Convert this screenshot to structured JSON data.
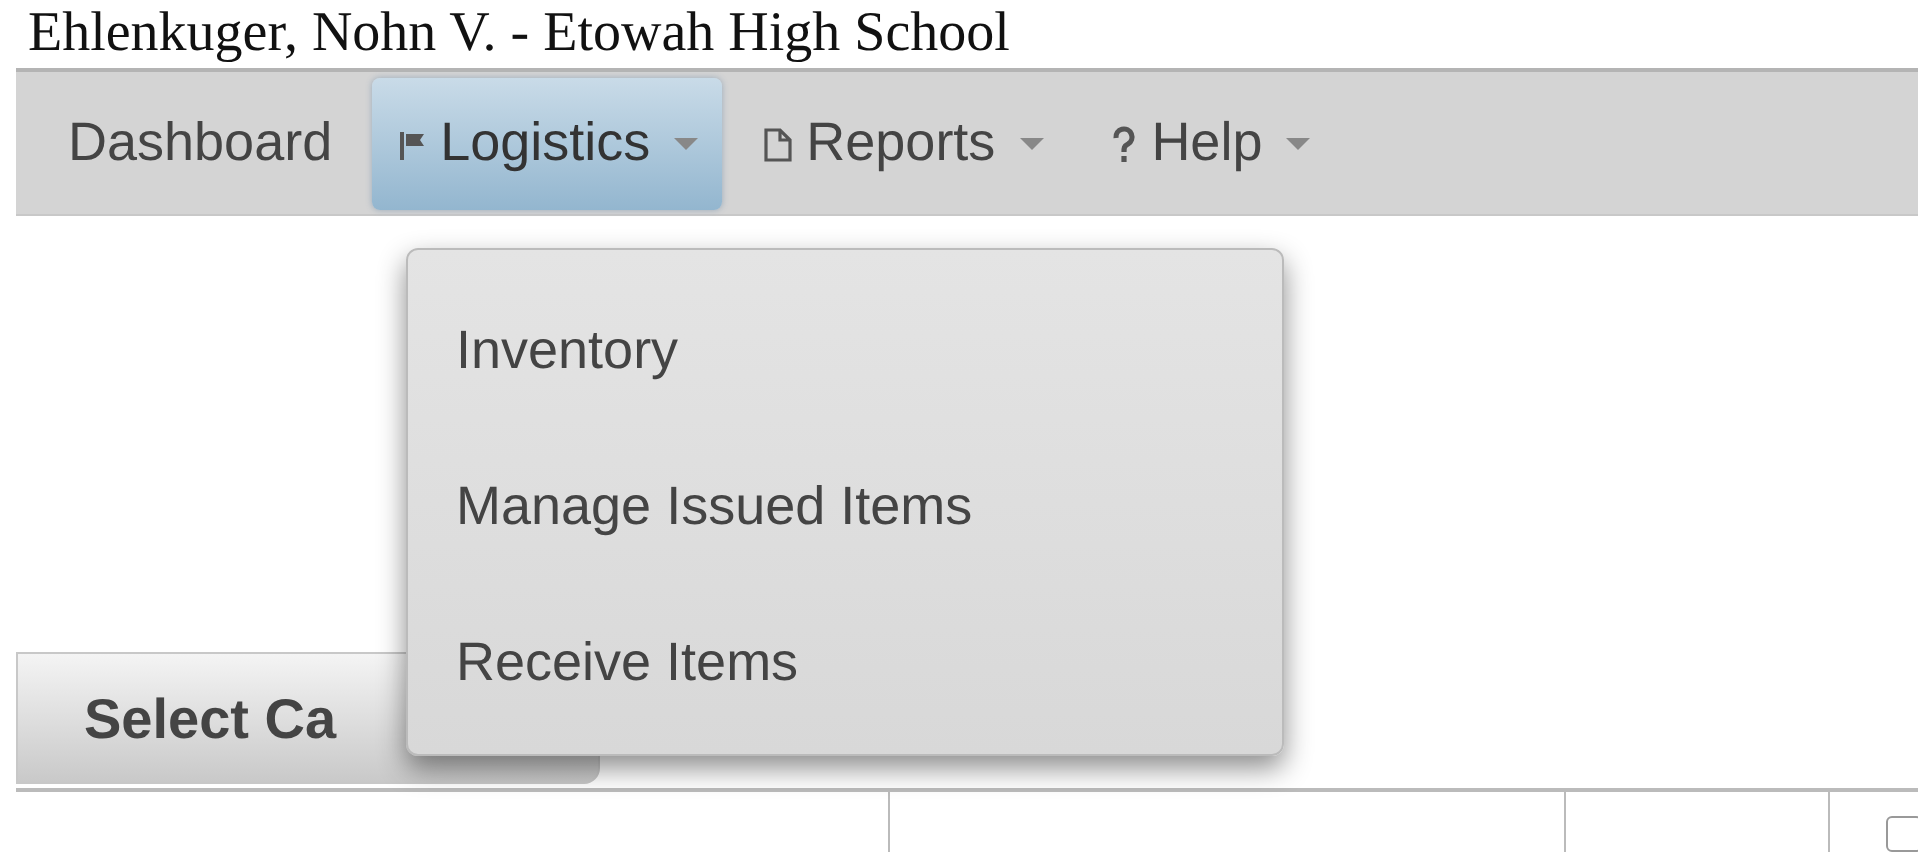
{
  "page_header": {
    "title": "Ehlenkuger, Nohn V. - Etowah High School"
  },
  "menu": [
    {
      "label": "Dashboard",
      "selected": false
    },
    {
      "label": "Logistics",
      "selected": true
    },
    {
      "label": "Reports",
      "selected": false
    },
    {
      "label": "Help",
      "selected": false
    }
  ],
  "dropdown": {
    "items": [
      "Inventory",
      "Manage Issued Items",
      "Receive Items"
    ]
  },
  "section_tab": {
    "label": "Select Ca"
  },
  "table": {
    "row_checkbox": {
      "checked": false
    }
  }
}
